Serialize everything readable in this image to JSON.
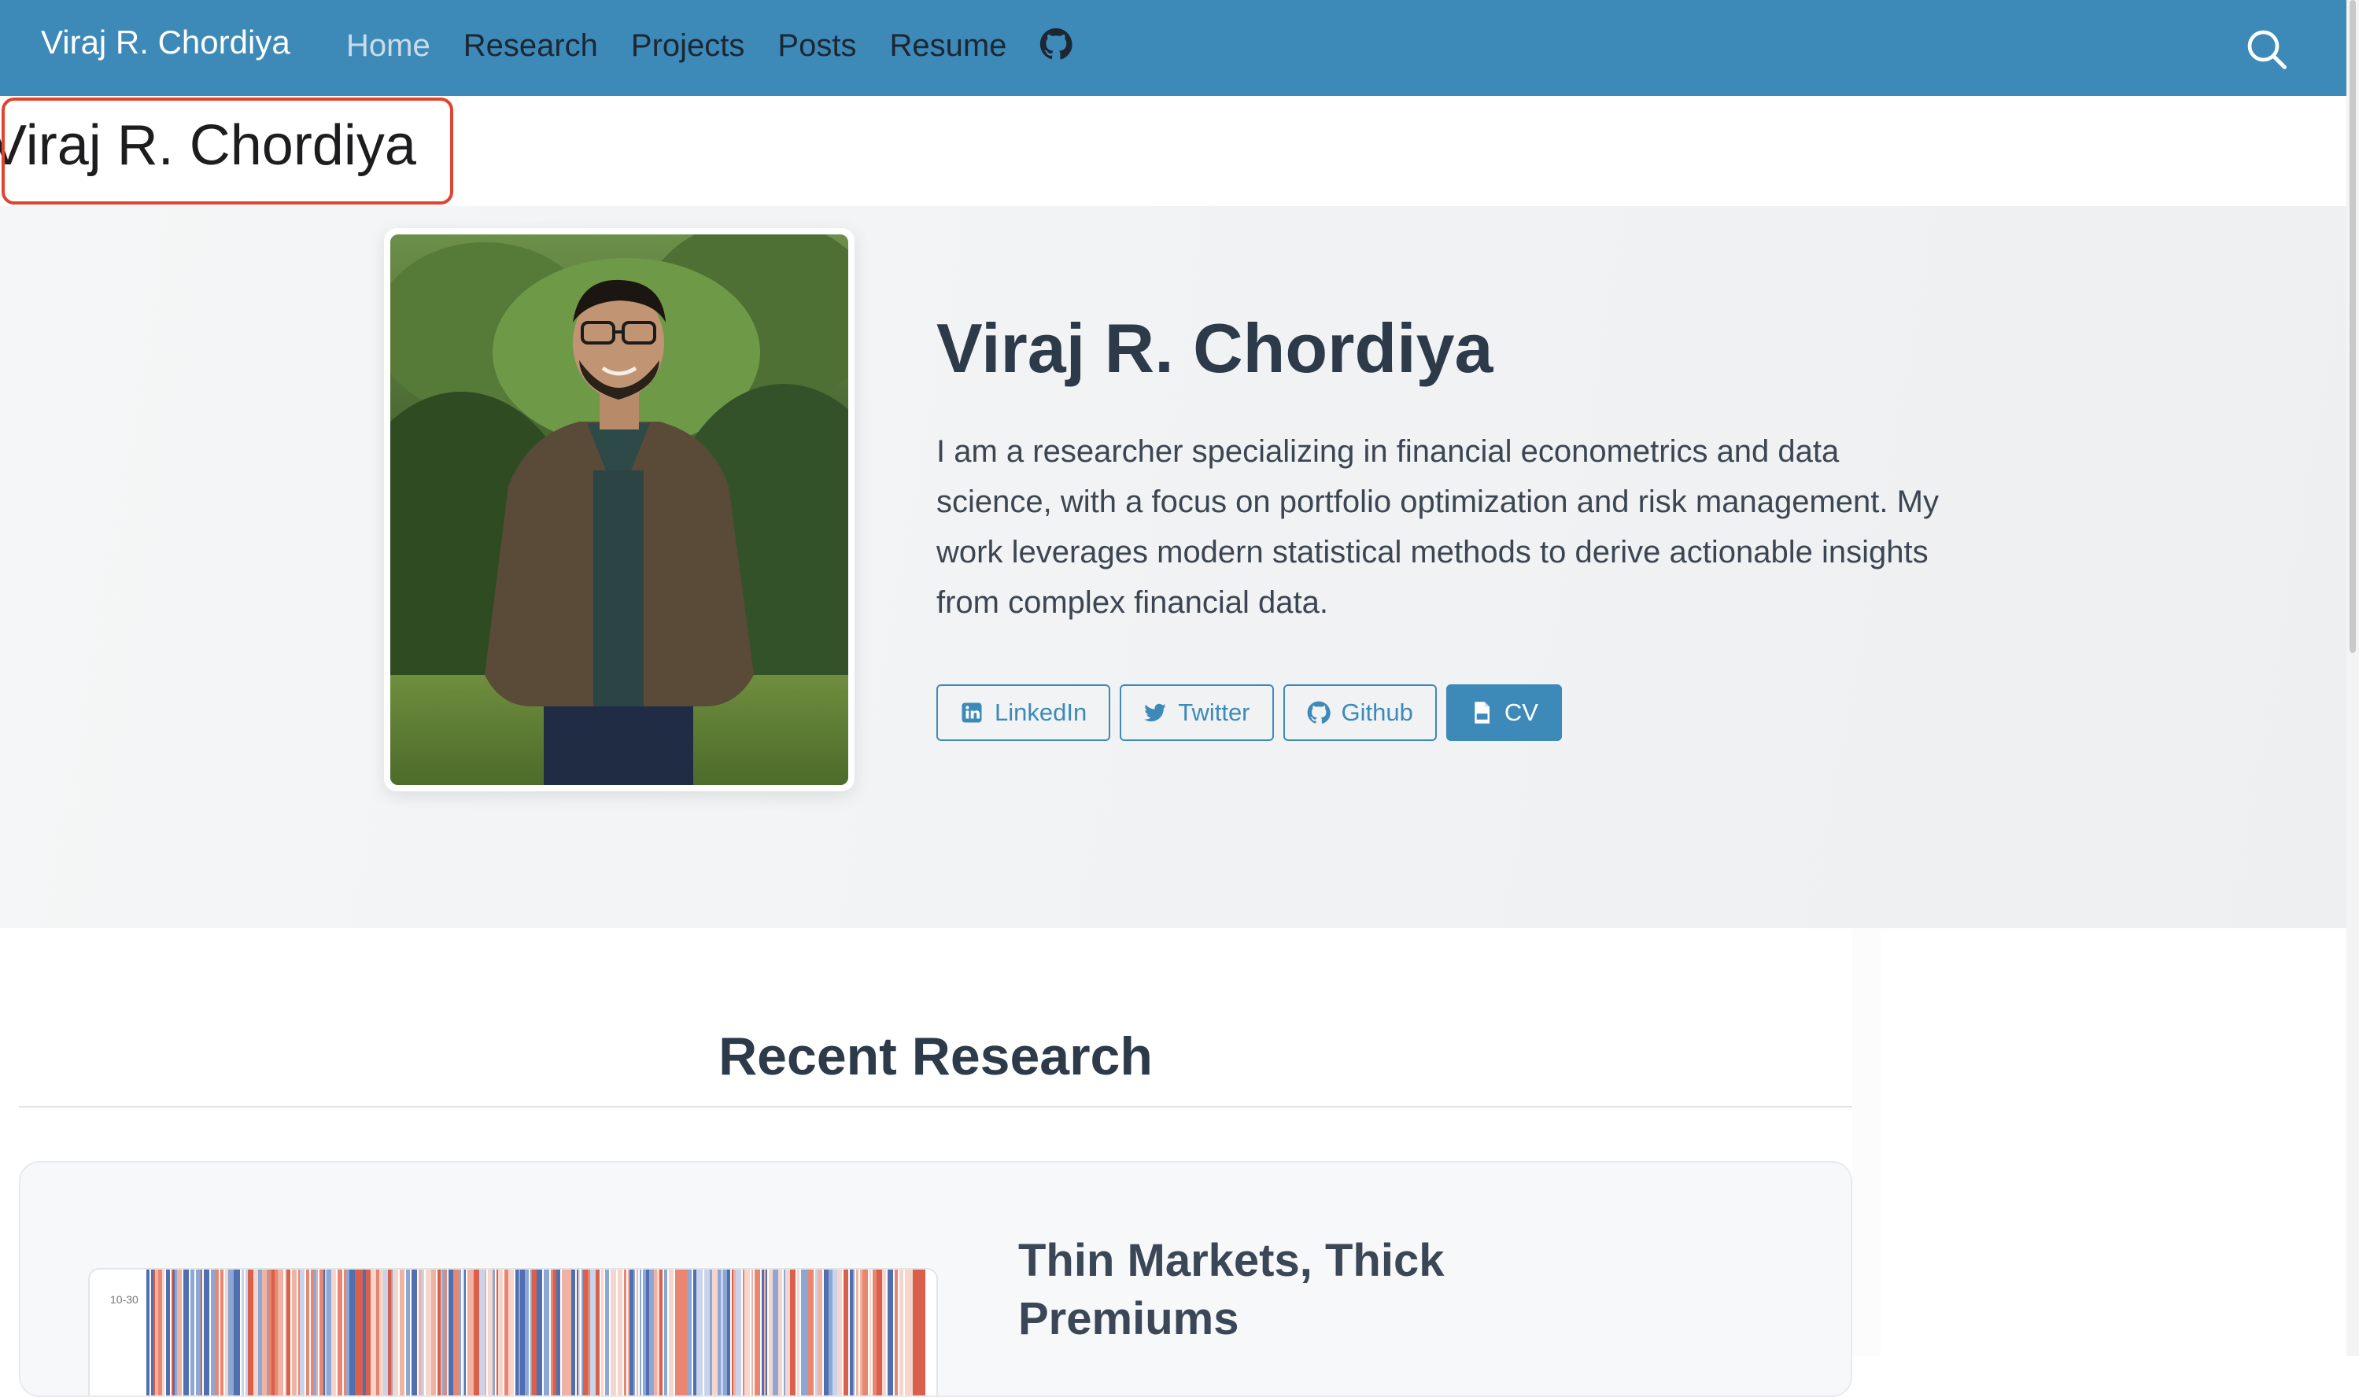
{
  "navbar": {
    "brand": "Viraj R. Chordiya",
    "links": [
      {
        "label": "Home",
        "active": true
      },
      {
        "label": "Research"
      },
      {
        "label": "Projects"
      },
      {
        "label": "Posts"
      },
      {
        "label": "Resume"
      }
    ],
    "icons": [
      "github-icon",
      "search-icon"
    ]
  },
  "page": {
    "title": "Viraj R. Chordiya"
  },
  "hero": {
    "name": "Viraj R. Chordiya",
    "bio": "I am a researcher specializing in financial econometrics and data science, with a focus on portfolio optimization and risk management. My work leverages modern statistical methods to derive actionable insights from complex financial data.",
    "links": [
      {
        "label": "LinkedIn",
        "icon": "linkedin-icon"
      },
      {
        "label": "Twitter",
        "icon": "twitter-icon"
      },
      {
        "label": "Github",
        "icon": "github-icon"
      },
      {
        "label": "CV",
        "icon": "pdf-icon"
      }
    ]
  },
  "research": {
    "heading": "Recent Research",
    "items": [
      {
        "title": "Thin Markets, Thick Premiums",
        "thumb_label": "10-30"
      }
    ]
  },
  "colors": {
    "primary": "#3d8ab9",
    "focus": "#e0432e",
    "text": "#2c3a4a"
  }
}
